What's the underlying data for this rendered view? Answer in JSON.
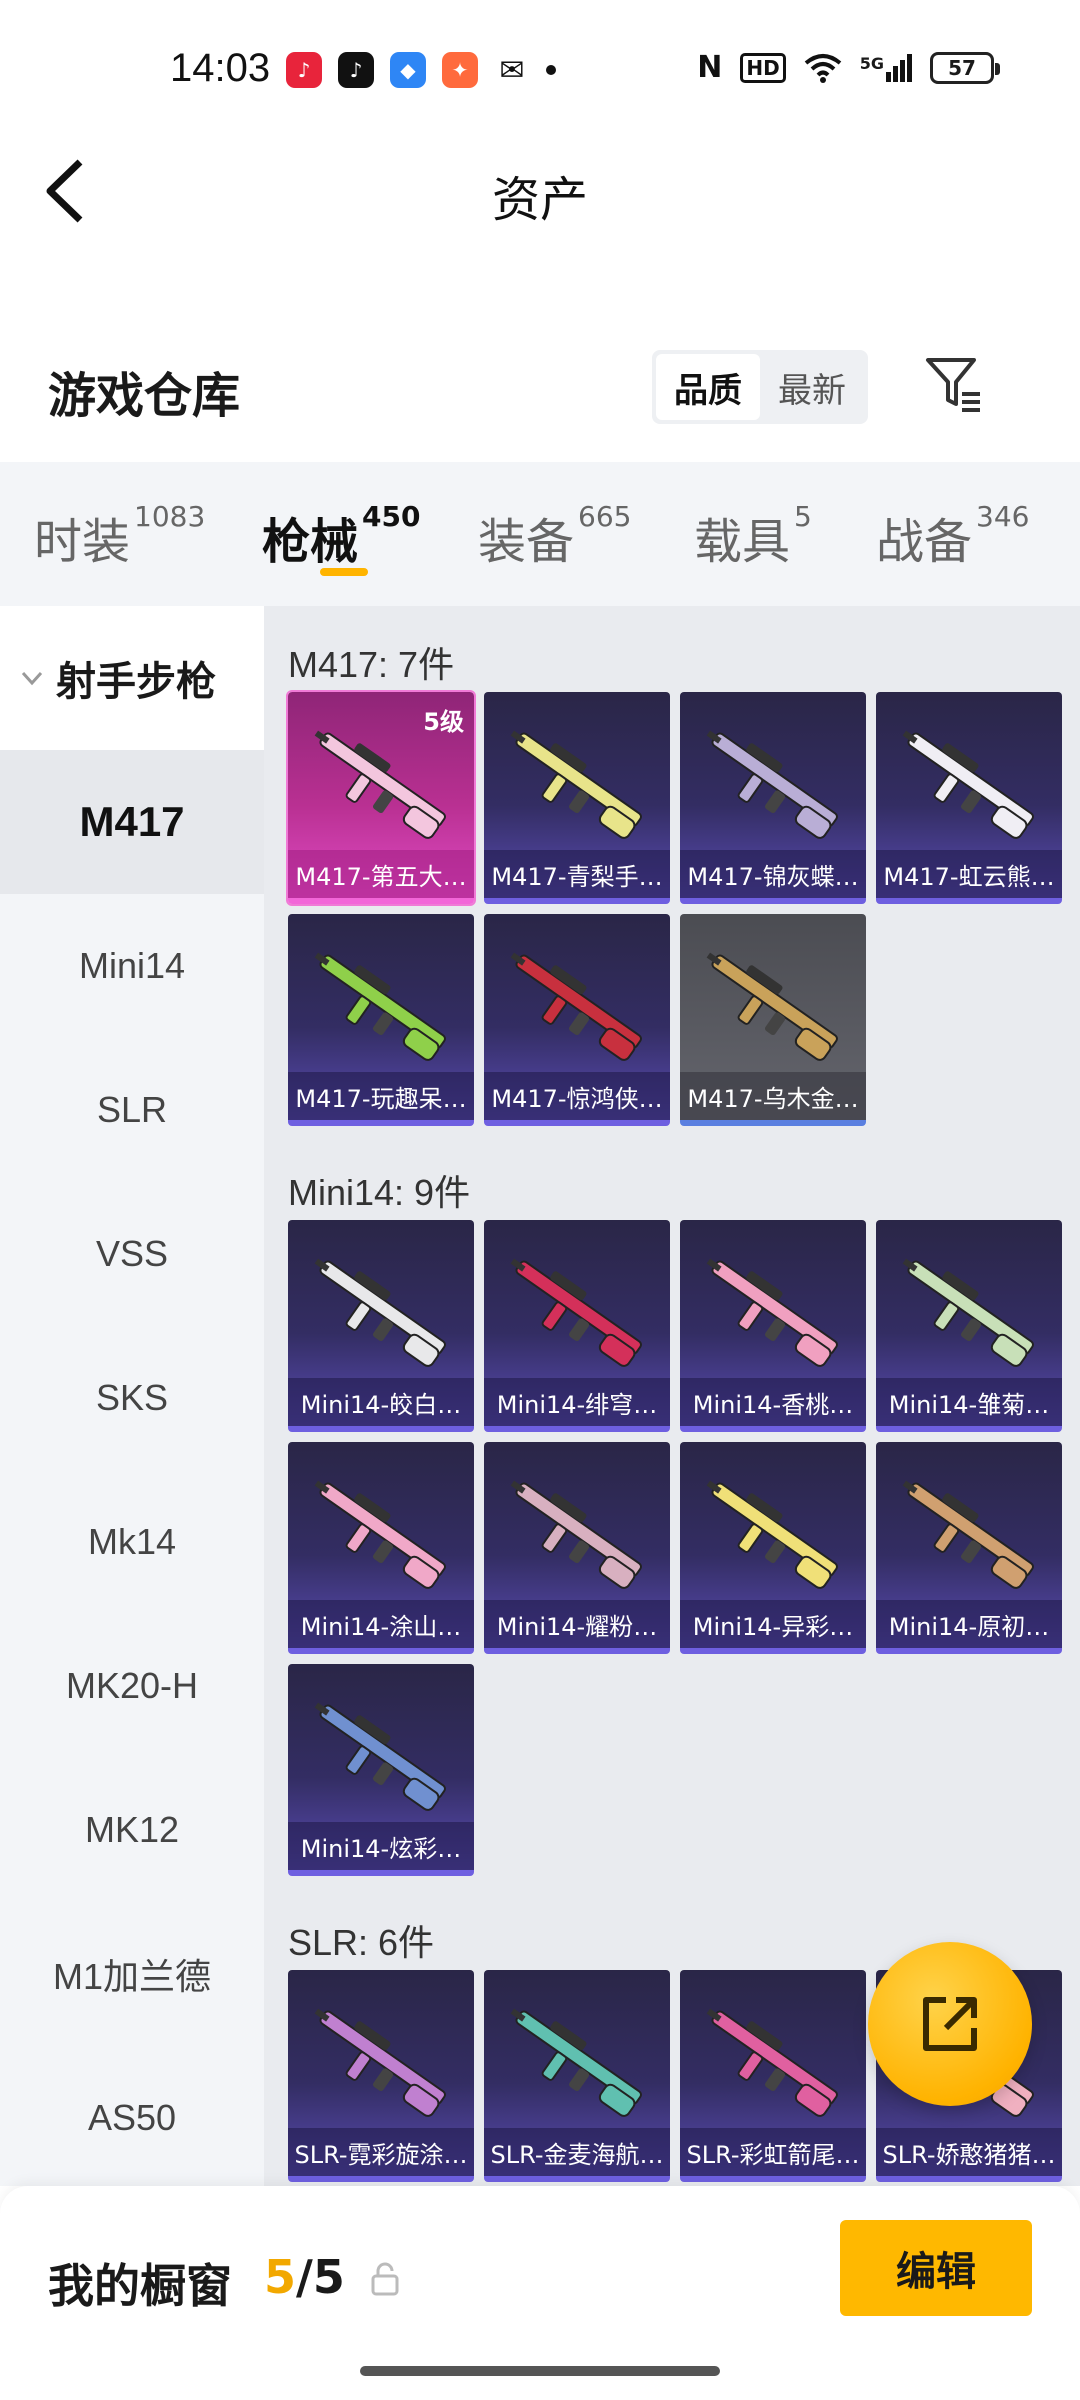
{
  "status_bar": {
    "time": "14:03",
    "signal": "5G",
    "battery": "57",
    "hd": "HD",
    "nfc": "N"
  },
  "header": {
    "title": "资产"
  },
  "warehouse": {
    "title": "游戏仓库",
    "sort_options": [
      "品质",
      "最新"
    ],
    "active_sort": "品质"
  },
  "tabs": [
    {
      "label": "时装",
      "count": "1083"
    },
    {
      "label": "枪械",
      "count": "450"
    },
    {
      "label": "装备",
      "count": "665"
    },
    {
      "label": "载具",
      "count": "5"
    },
    {
      "label": "战备",
      "count": "346"
    }
  ],
  "active_tab": "枪械",
  "sidebar": {
    "group": "射手步枪",
    "items": [
      "M417",
      "Mini14",
      "SLR",
      "VSS",
      "SKS",
      "Mk14",
      "MK20-H",
      "MK12",
      "M1加兰德",
      "AS50"
    ],
    "active": "M417"
  },
  "sections": [
    {
      "title": "M417: 7件",
      "items": [
        {
          "label": "M417-第五大…",
          "badge": "5级",
          "style": "pink"
        },
        {
          "label": "M417-青梨手…",
          "style": "purple"
        },
        {
          "label": "M417-锦灰蝶…",
          "style": "purple"
        },
        {
          "label": "M417-虹云熊…",
          "style": "purple"
        },
        {
          "label": "M417-玩趣呆…",
          "style": "purple"
        },
        {
          "label": "M417-惊鸿侠…",
          "style": "purple"
        },
        {
          "label": "M417-乌木金…",
          "style": "gray"
        }
      ]
    },
    {
      "title": "Mini14: 9件",
      "items": [
        {
          "label": "Mini14-皎白…",
          "style": "purple"
        },
        {
          "label": "Mini14-绯穹…",
          "style": "purple"
        },
        {
          "label": "Mini14-香桃…",
          "style": "purple"
        },
        {
          "label": "Mini14-雏菊…",
          "style": "purple"
        },
        {
          "label": "Mini14-涂山…",
          "style": "purple"
        },
        {
          "label": "Mini14-耀粉…",
          "style": "purple"
        },
        {
          "label": "Mini14-异彩…",
          "style": "purple"
        },
        {
          "label": "Mini14-原初…",
          "style": "purple"
        },
        {
          "label": "Mini14-炫彩…",
          "style": "purple"
        }
      ]
    },
    {
      "title": "SLR: 6件",
      "items": [
        {
          "label": "SLR-霓彩旋涂…",
          "style": "purple"
        },
        {
          "label": "SLR-金麦海航…",
          "style": "purple"
        },
        {
          "label": "SLR-彩虹箭尾…",
          "style": "purple"
        },
        {
          "label": "SLR-娇憨猪猪…",
          "style": "purple"
        }
      ]
    }
  ],
  "bottom_bar": {
    "label": "我的橱窗",
    "current": "5",
    "separator": "/",
    "total": "5",
    "edit_label": "编辑"
  },
  "colors": {
    "accent": "#ffb800",
    "card_purple": "#332d63",
    "card_pink": "#b93092",
    "card_gray": "#5a5b62"
  },
  "icons": [
    "back-arrow-icon",
    "filter-icon",
    "chevron-down-icon",
    "share-export-icon",
    "lock-icon",
    "wifi-icon",
    "signal-icon",
    "nfc-icon",
    "battery-icon"
  ]
}
